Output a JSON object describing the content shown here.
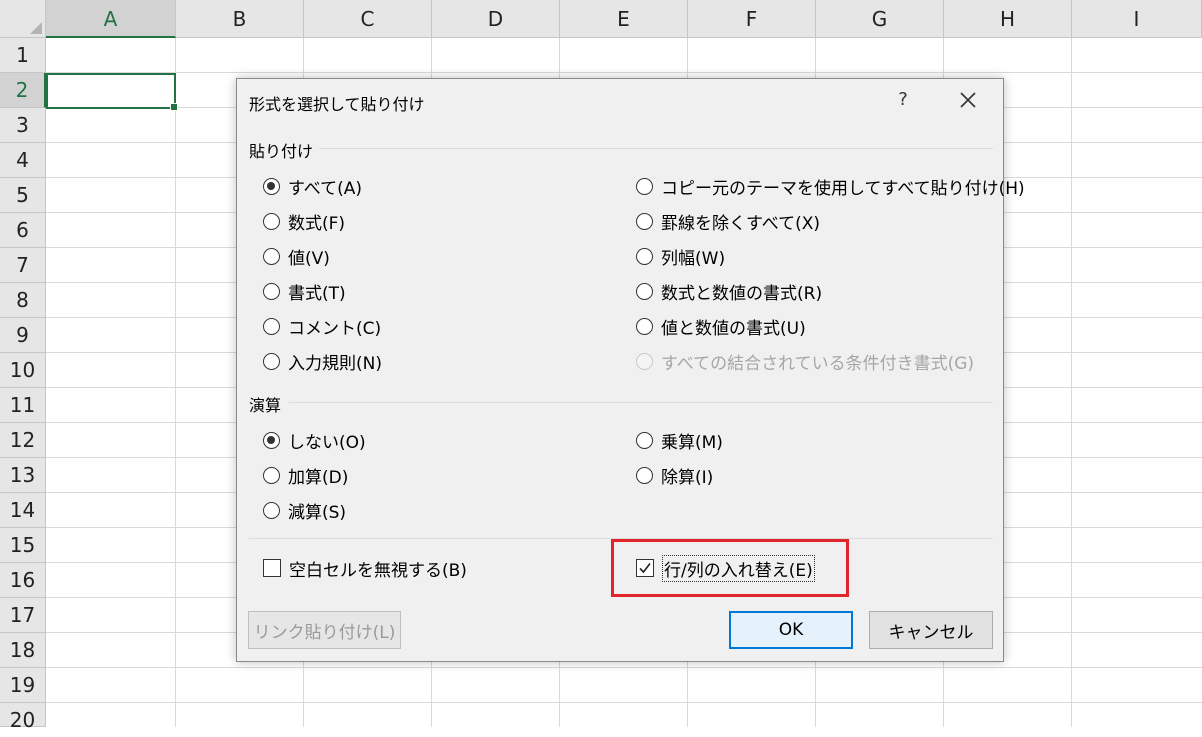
{
  "sheet": {
    "columns": [
      "A",
      "B",
      "C",
      "D",
      "E",
      "F",
      "G",
      "H",
      "I"
    ],
    "rows": [
      "1",
      "2",
      "3",
      "4",
      "5",
      "6",
      "7",
      "8",
      "9",
      "10",
      "11",
      "12",
      "13",
      "14",
      "15",
      "16",
      "17",
      "18",
      "19",
      "20"
    ],
    "selected_column": "A",
    "selected_row": "2"
  },
  "dialog": {
    "title": "形式を選択して貼り付け",
    "help_label": "?",
    "paste_group": {
      "label": "貼り付け",
      "left": [
        {
          "label": "すべて(A)",
          "checked": true
        },
        {
          "label": "数式(F)",
          "checked": false
        },
        {
          "label": "値(V)",
          "checked": false
        },
        {
          "label": "書式(T)",
          "checked": false
        },
        {
          "label": "コメント(C)",
          "checked": false
        },
        {
          "label": "入力規則(N)",
          "checked": false
        }
      ],
      "right": [
        {
          "label": "コピー元のテーマを使用してすべて貼り付け(H)",
          "checked": false,
          "disabled": false
        },
        {
          "label": "罫線を除くすべて(X)",
          "checked": false,
          "disabled": false
        },
        {
          "label": "列幅(W)",
          "checked": false,
          "disabled": false
        },
        {
          "label": "数式と数値の書式(R)",
          "checked": false,
          "disabled": false
        },
        {
          "label": "値と数値の書式(U)",
          "checked": false,
          "disabled": false
        },
        {
          "label": "すべての結合されている条件付き書式(G)",
          "checked": false,
          "disabled": true
        }
      ]
    },
    "operation_group": {
      "label": "演算",
      "left": [
        {
          "label": "しない(O)",
          "checked": true
        },
        {
          "label": "加算(D)",
          "checked": false
        },
        {
          "label": "減算(S)",
          "checked": false
        }
      ],
      "right": [
        {
          "label": "乗算(M)",
          "checked": false
        },
        {
          "label": "除算(I)",
          "checked": false
        }
      ]
    },
    "skip_blanks": {
      "label": "空白セルを無視する(B)",
      "checked": false
    },
    "transpose": {
      "label": "行/列の入れ替え(E)",
      "checked": true
    },
    "buttons": {
      "paste_link": "リンク貼り付け(L)",
      "ok": "OK",
      "cancel": "キャンセル"
    },
    "highlight_color": "#e2242c",
    "accent_color": "#0078d7"
  }
}
